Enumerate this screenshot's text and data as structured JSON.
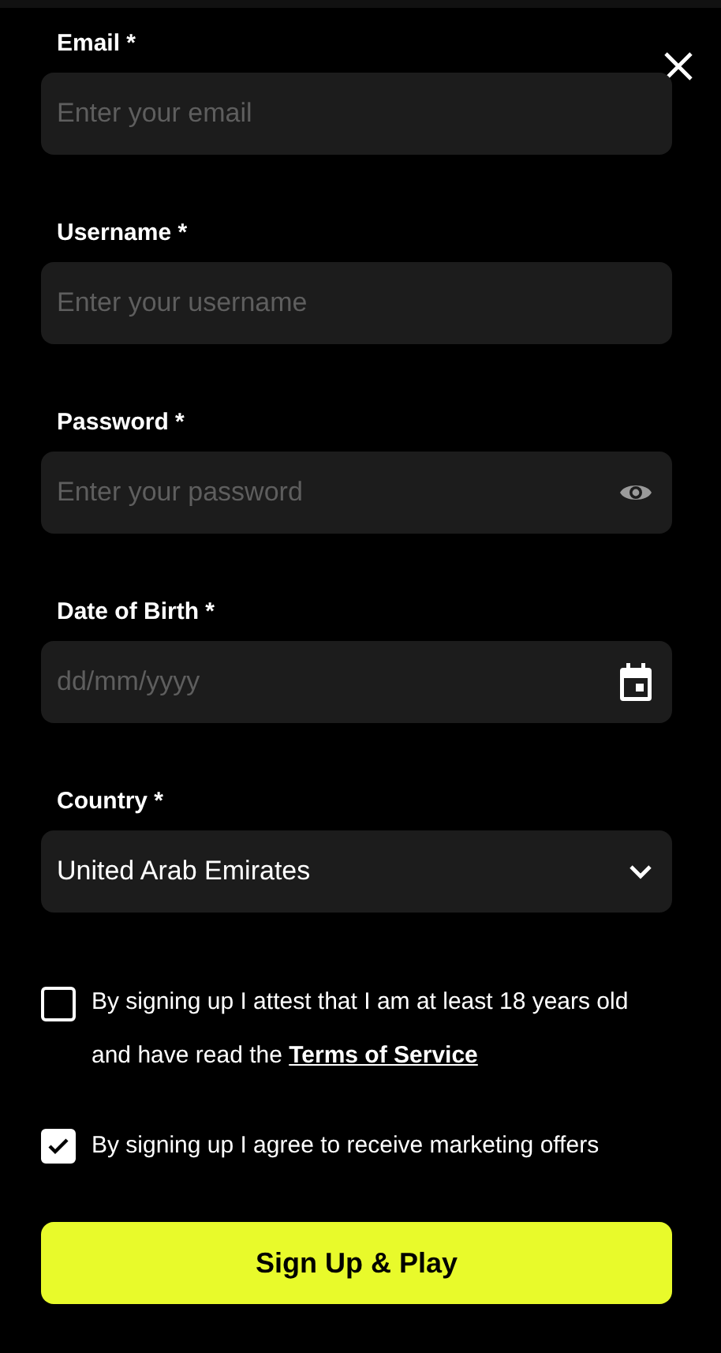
{
  "fields": [
    {
      "kind": "text",
      "label": "Email *",
      "placeholder": "Enter your email"
    },
    {
      "kind": "text",
      "label": "Username *",
      "placeholder": "Enter your username"
    },
    {
      "kind": "password",
      "label": "Password *",
      "placeholder": "Enter your password"
    },
    {
      "kind": "date",
      "label": "Date of Birth *",
      "placeholder": "dd/mm/yyyy"
    },
    {
      "kind": "select",
      "label": "Country *",
      "value": "United Arab Emirates"
    }
  ],
  "consents": [
    {
      "checked": false,
      "text": "By signing up I attest that I am at least 18 years old and have read the",
      "link": "Terms of Service"
    },
    {
      "checked": true,
      "text": "By signing up I agree to receive marketing offers"
    }
  ],
  "submit": "Sign Up & Play"
}
